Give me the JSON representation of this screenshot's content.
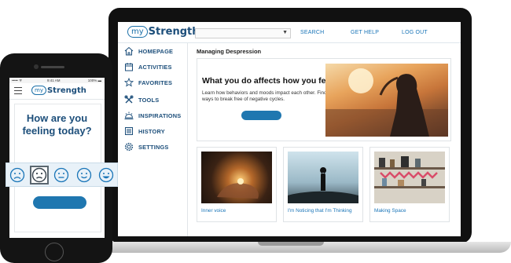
{
  "laptop": {
    "logo": {
      "pill": "my",
      "word": "Strength"
    },
    "nav": {
      "search": "SEARCH",
      "help": "GET HELP",
      "logout": "LOG OUT"
    },
    "sidebar": [
      {
        "label": "HOMEPAGE",
        "icon": "home-icon"
      },
      {
        "label": "ACTIVITIES",
        "icon": "calendar-icon"
      },
      {
        "label": "FAVORITES",
        "icon": "star-icon"
      },
      {
        "label": "TOOLS",
        "icon": "tools-icon"
      },
      {
        "label": "INSPIRATIONS",
        "icon": "sun-icon"
      },
      {
        "label": "HISTORY",
        "icon": "list-icon"
      },
      {
        "label": "SETTINGS",
        "icon": "gear-icon"
      }
    ],
    "main_title": "Managing Despression",
    "hero": {
      "title": "What you do affects how you feel",
      "body": "Learn how behaviors and moods impact each other. Find ways to break free of negative cycles."
    },
    "cards": [
      {
        "title": "Inner voice"
      },
      {
        "title": "I'm Noticing that I'm Thinking"
      },
      {
        "title": "Making Space"
      }
    ]
  },
  "phone": {
    "status": {
      "signal": "••••• ᯤ",
      "time": "9:41 AM",
      "battery": "100% ▬"
    },
    "logo": {
      "pill": "my",
      "word": "Strength"
    },
    "question_line1": "How are you",
    "question_line2": "feeling today?",
    "moods": [
      "very-sad",
      "sad",
      "neutral",
      "happy",
      "very-happy"
    ],
    "selected_mood": "sad"
  },
  "colors": {
    "brand_blue": "#1c4e7a",
    "link_blue": "#1a75b8",
    "button_blue": "#1f77b0"
  }
}
